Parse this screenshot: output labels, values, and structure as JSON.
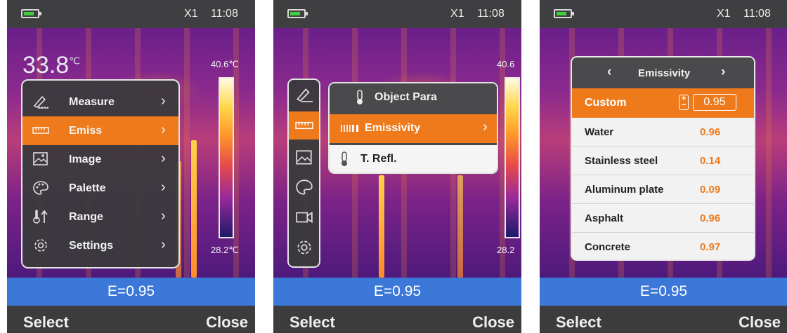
{
  "colors": {
    "accent": "#ee7a1c",
    "ebar": "#3b78d8",
    "menu": "#3a3a3c",
    "battery": "#3fd13b"
  },
  "status": {
    "zoom": "X1",
    "time": "11:08"
  },
  "footer": {
    "emissivity": "E=0.95",
    "select": "Select",
    "close": "Close"
  },
  "screen1": {
    "temp": "33.8",
    "temp_unit": "℃",
    "scale_max": "40.6℃",
    "scale_min": "28.2℃",
    "menu": [
      {
        "label": "Measure",
        "icon": "measure-icon"
      },
      {
        "label": "Emiss",
        "icon": "emissivity-icon",
        "selected": true
      },
      {
        "label": "Image",
        "icon": "image-icon"
      },
      {
        "label": "Palette",
        "icon": "palette-icon"
      },
      {
        "label": "Range",
        "icon": "range-icon"
      },
      {
        "label": "Settings",
        "icon": "gear-icon"
      }
    ]
  },
  "screen2": {
    "scale_max": "40.6",
    "scale_min": "28.2",
    "submenu": {
      "header": "Object Para",
      "selected": "Emissivity",
      "other": "T. Refl."
    }
  },
  "screen3": {
    "title": "Emissivity",
    "custom_label": "Custom",
    "custom_value": "0.95",
    "materials": [
      {
        "name": "Water",
        "value": "0.96"
      },
      {
        "name": "Stainless steel",
        "value": "0.14"
      },
      {
        "name": "Aluminum plate",
        "value": "0.09"
      },
      {
        "name": "Asphalt",
        "value": "0.96"
      },
      {
        "name": "Concrete",
        "value": "0.97"
      }
    ]
  }
}
